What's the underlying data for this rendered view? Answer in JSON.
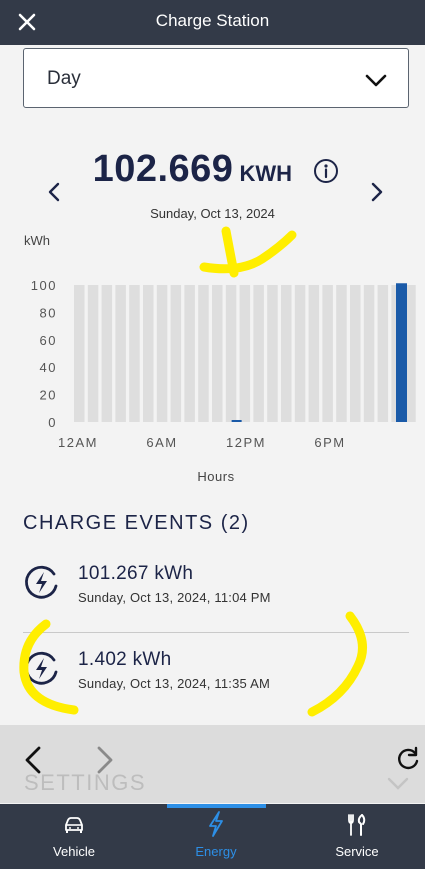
{
  "header": {
    "title": "Charge Station"
  },
  "range_select": {
    "value": "Day"
  },
  "summary": {
    "total": "102.669",
    "unit": "KWH",
    "date": "Sunday, Oct 13, 2024"
  },
  "chart_data": {
    "type": "bar",
    "ylabel": "kWh",
    "xlabel": "Hours",
    "y_ticks": [
      "100",
      "80",
      "60",
      "40",
      "20",
      "0"
    ],
    "x_ticks": [
      "12AM",
      "6AM",
      "12PM",
      "6PM"
    ],
    "ylim": [
      0,
      100
    ],
    "bar_count": 25,
    "values": [
      0,
      0,
      0,
      0,
      0,
      0,
      0,
      0,
      0,
      0,
      0,
      1.402,
      0,
      0,
      0,
      0,
      0,
      0,
      0,
      0,
      0,
      0,
      0,
      101.267
    ],
    "max_background": 100,
    "grid": false,
    "colors": {
      "background_bar": "#dedede",
      "value_bar": "#1a5aa8"
    }
  },
  "charge_events": {
    "title": "CHARGE EVENTS (2)",
    "items": [
      {
        "kwh": "101.267 kWh",
        "when": "Sunday, Oct 13, 2024, 11:04 PM"
      },
      {
        "kwh": "1.402 kWh",
        "when": "Sunday, Oct 13, 2024, 11:35 AM"
      }
    ]
  },
  "settings_ghost": "SETTINGS",
  "bottom_nav": {
    "tabs": [
      {
        "label": "Vehicle",
        "icon": "car-icon"
      },
      {
        "label": "Energy",
        "icon": "lightning-icon",
        "active": true
      },
      {
        "label": "Service",
        "icon": "tools-icon"
      }
    ]
  },
  "colors": {
    "header_bg": "#333a48",
    "accent": "#2d8fe6",
    "annotation": "#ffee00"
  }
}
